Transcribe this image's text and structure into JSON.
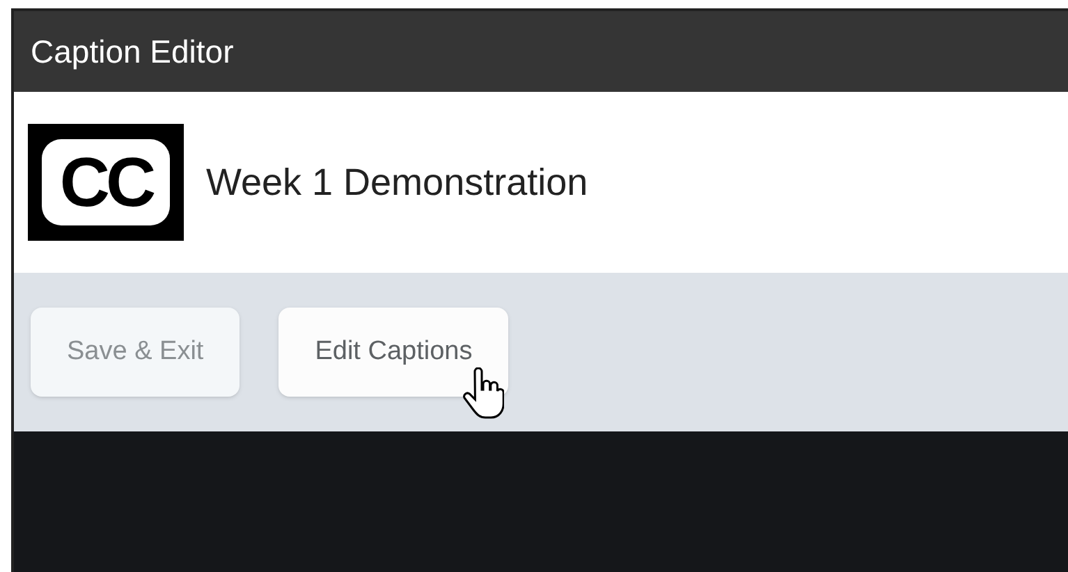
{
  "window": {
    "title": "Caption Editor"
  },
  "header": {
    "logo": "CC",
    "title": "Week 1 Demonstration"
  },
  "buttons": [
    {
      "label": "Save & Exit",
      "disabled": true
    },
    {
      "label": "Edit Captions",
      "disabled": false
    }
  ]
}
